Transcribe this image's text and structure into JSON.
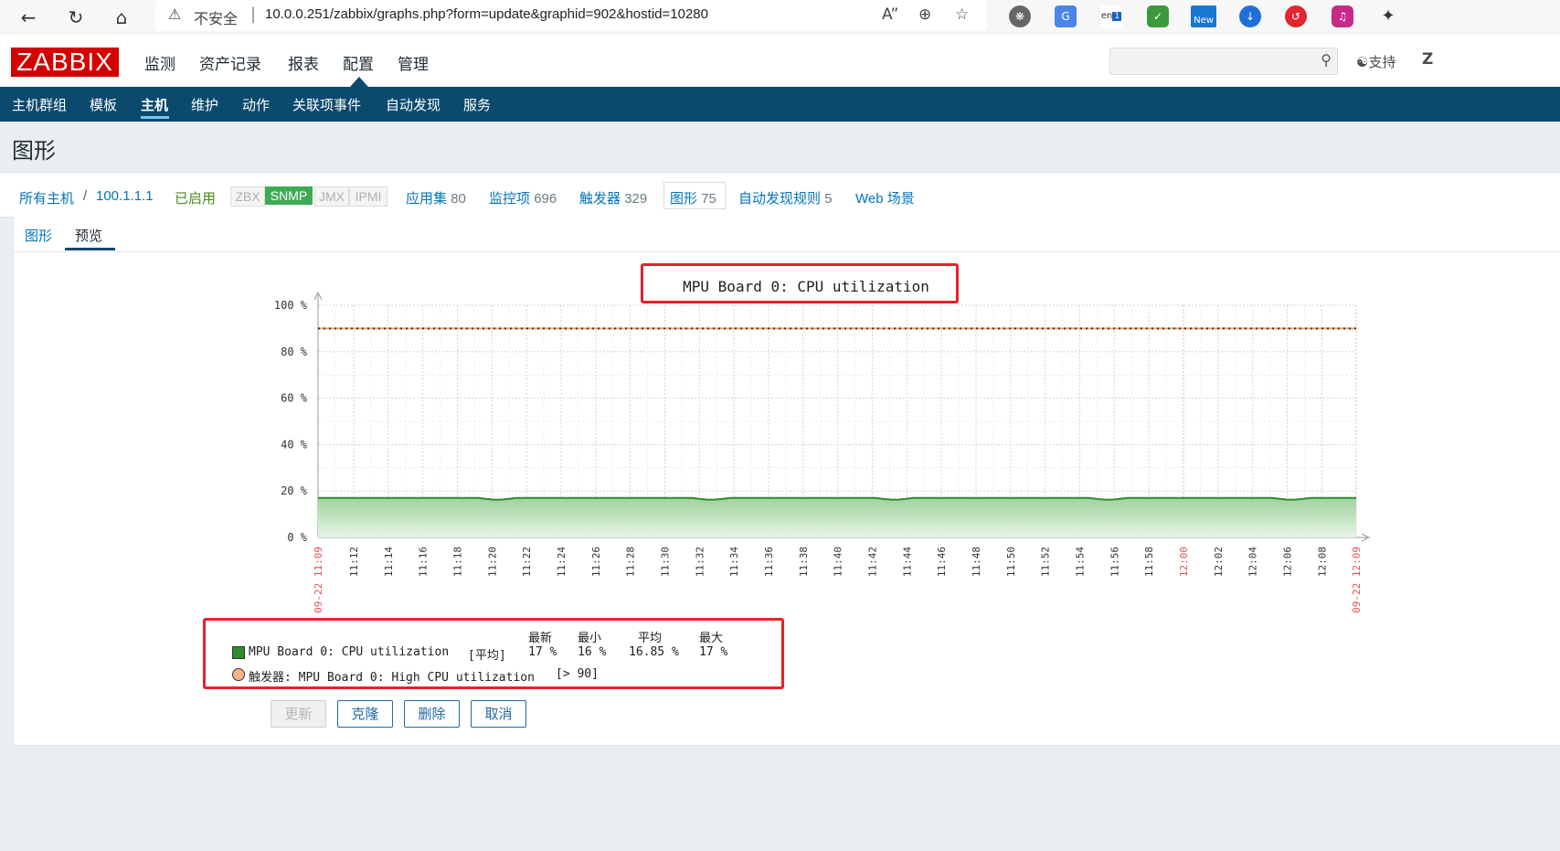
{
  "browser": {
    "insecure_label": "不安全",
    "separator": "|",
    "url": "10.0.0.251/zabbix/graphs.php?form=update&graphid=902&hostid=10280",
    "ext_new_label": "New",
    "ext_badge": "1",
    "ext_lang_label": "en"
  },
  "header": {
    "logo": "ZABBIX",
    "menu": [
      "监测",
      "资产记录",
      "报表",
      "配置",
      "管理"
    ],
    "active_menu": "配置",
    "search_placeholder": "",
    "support_label": "支持",
    "user_initial": "Z"
  },
  "submenu": {
    "items": [
      "主机群组",
      "模板",
      "主机",
      "维护",
      "动作",
      "关联项事件",
      "自动发现",
      "服务"
    ],
    "active": "主机"
  },
  "page_title": "图形",
  "breadcrumb": {
    "all_hosts": "所有主机",
    "slash": "/",
    "host": "100.1.1.1",
    "status": "已启用",
    "protocols": [
      {
        "label": "ZBX",
        "active": false
      },
      {
        "label": "SNMP",
        "active": true
      },
      {
        "label": "JMX",
        "active": false
      },
      {
        "label": "IPMI",
        "active": false
      }
    ],
    "links": [
      {
        "label": "应用集",
        "count": "80"
      },
      {
        "label": "监控项",
        "count": "696"
      },
      {
        "label": "触发器",
        "count": "329"
      },
      {
        "label": "图形",
        "count": "75"
      },
      {
        "label": "自动发现规则",
        "count": "5"
      },
      {
        "label": "Web 场景",
        "count": ""
      }
    ]
  },
  "tabs": [
    "图形",
    "预览"
  ],
  "active_tab": "预览",
  "chart_data": {
    "type": "area",
    "title": "MPU Board 0: CPU utilization",
    "y_ticks": [
      "0 %",
      "20 %",
      "40 %",
      "60 %",
      "80 %",
      "100 %"
    ],
    "ylim": [
      0,
      100
    ],
    "x_ticks": [
      "09-22 11:09",
      "11:12",
      "11:14",
      "11:16",
      "11:18",
      "11:20",
      "11:22",
      "11:24",
      "11:26",
      "11:28",
      "11:30",
      "11:32",
      "11:34",
      "11:36",
      "11:38",
      "11:40",
      "11:42",
      "11:44",
      "11:46",
      "11:48",
      "11:50",
      "11:52",
      "11:54",
      "11:56",
      "11:58",
      "12:00",
      "12:02",
      "12:04",
      "12:06",
      "12:08",
      "09-22 12:09"
    ],
    "red_ticks": [
      "09-22 11:09",
      "12:00",
      "09-22 12:09"
    ],
    "series": [
      {
        "name": "MPU Board 0: CPU utilization",
        "color": "#2e8b2e",
        "values": [
          17,
          17,
          17,
          17,
          17,
          17,
          17,
          17,
          17,
          17,
          17,
          17,
          17,
          17,
          17,
          17,
          17,
          17,
          17,
          17,
          17,
          17,
          16.6,
          16.3,
          16.3,
          16.6,
          17,
          17,
          17,
          17,
          17,
          17,
          17,
          17,
          17,
          17,
          17,
          17,
          17,
          17,
          17,
          17,
          17,
          17,
          17,
          17,
          17,
          17,
          17,
          17,
          16.6,
          16.3,
          16.3,
          16.6,
          17,
          17,
          17,
          17,
          17,
          17,
          17,
          17,
          17,
          17,
          17,
          17,
          17,
          17,
          17,
          17,
          17,
          17,
          17,
          17,
          16.6,
          16.3,
          16.3,
          16.6,
          17,
          17,
          17,
          17,
          17,
          17,
          17,
          17,
          17,
          17,
          17,
          17,
          17,
          17,
          17,
          17,
          17,
          17,
          17,
          17,
          17,
          17,
          17,
          17,
          16.6,
          16.3,
          16.3,
          16.6,
          17,
          17,
          17,
          17,
          17,
          17,
          17,
          17,
          17,
          17,
          17,
          17,
          17,
          17,
          17,
          17,
          17,
          17,
          17,
          17,
          16.6,
          16.3,
          16.3,
          16.6,
          17,
          17,
          17,
          17,
          17,
          17,
          17
        ]
      }
    ],
    "trigger_value": 90,
    "trigger_color": "#f0a36a",
    "legend": {
      "headers": [
        "最新",
        "最小",
        "平均",
        "最大"
      ],
      "rows": [
        {
          "swatch": "#2e8b2e",
          "name": "MPU Board 0: CPU utilization",
          "func": "[平均]",
          "last": "17 %",
          "min": "16 %",
          "avg": "16.85 %",
          "max": "17 %"
        }
      ],
      "trigger": {
        "swatch": "#f7b48d",
        "name": "触发器: MPU Board 0: High CPU utilization",
        "cond": "[> 90]"
      }
    }
  },
  "buttons": {
    "update": "更新",
    "clone": "克隆",
    "delete": "删除",
    "cancel": "取消"
  }
}
